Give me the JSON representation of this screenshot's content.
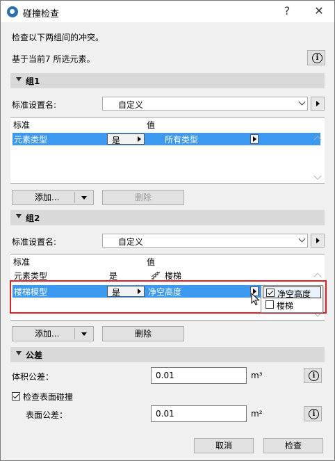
{
  "window": {
    "title": "碰撞检查",
    "help_glyph": "?",
    "close_glyph": "✕"
  },
  "intro": "检查以下两组间的冲突。",
  "selection_info": "基于当前7 所选元素。",
  "group1": {
    "header": "组1",
    "criteria_label": "标准设置名:",
    "criteria_value": "自定义",
    "table_headers": [
      "标准",
      "值"
    ],
    "rows": [
      {
        "criterion": "元素类型",
        "op": "是",
        "value": "所有类型"
      }
    ],
    "add_label": "添加...",
    "delete_label": "删除"
  },
  "group2": {
    "header": "组2",
    "criteria_label": "标准设置名:",
    "criteria_value": "自定义",
    "table_headers": [
      "标准",
      "值"
    ],
    "rows": [
      {
        "criterion": "元素类型",
        "op": "是",
        "value": "楼梯"
      },
      {
        "criterion": "楼梯模型",
        "op": "是",
        "value": "净空高度"
      }
    ],
    "popup_items": [
      {
        "label": "净空高度",
        "checked": true
      },
      {
        "label": "楼梯",
        "checked": false
      }
    ],
    "add_label": "添加...",
    "delete_label": "删除"
  },
  "tolerance": {
    "header": "公差",
    "volume_label": "体积公差：",
    "volume_value": "0.01",
    "volume_unit": "m³",
    "surface_check_label": "检查表面碰撞",
    "surface_check_checked": true,
    "surface_label": "表面公差：",
    "surface_value": "0.01",
    "surface_unit": "m²"
  },
  "footer": {
    "cancel": "取消",
    "check": "检查"
  },
  "icons": [
    "app-icon",
    "help-icon",
    "close-icon",
    "info-icon",
    "stair-icon",
    "chevron-down-icon",
    "arrow-right-icon",
    "mouse-cursor-icon"
  ],
  "colors": {
    "selection": "#3b9af0",
    "highlight_frame": "#e02020",
    "section_bar": "#d9d9d9"
  }
}
